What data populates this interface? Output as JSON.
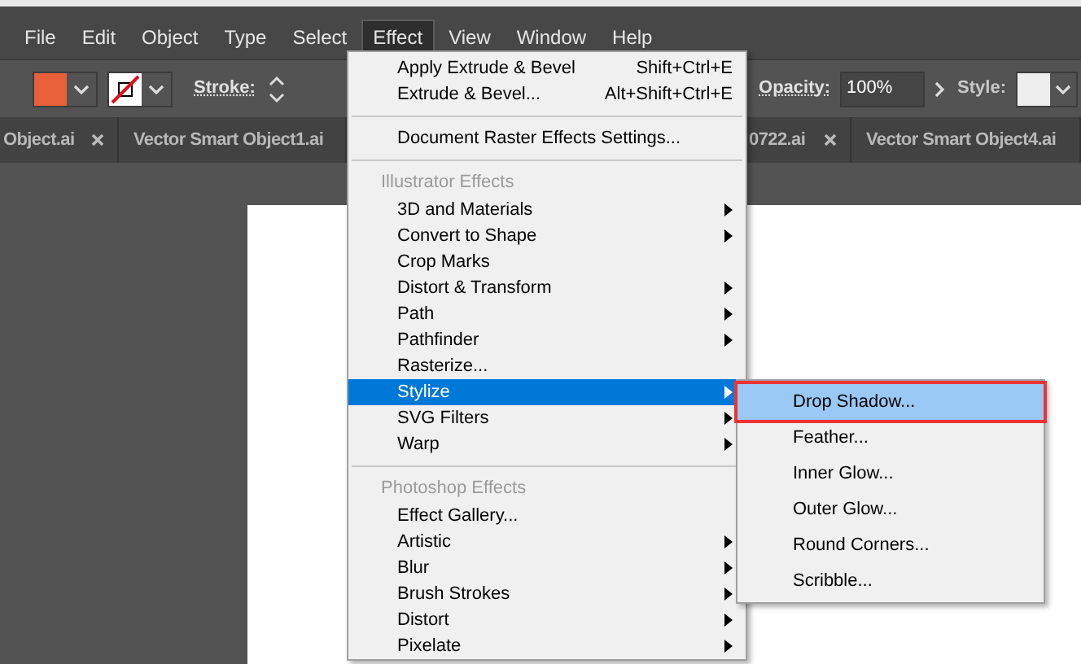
{
  "menu_bar": [
    {
      "label": "File",
      "selected": false
    },
    {
      "label": "Edit",
      "selected": false
    },
    {
      "label": "Object",
      "selected": false
    },
    {
      "label": "Type",
      "selected": false
    },
    {
      "label": "Select",
      "selected": false
    },
    {
      "label": "Effect",
      "selected": true
    },
    {
      "label": "View",
      "selected": false
    },
    {
      "label": "Window",
      "selected": false
    },
    {
      "label": "Help",
      "selected": false
    }
  ],
  "toolbar": {
    "stroke_label": "Stroke:",
    "opacity_label": "Opacity:",
    "opacity_value": "100%",
    "style_label": "Style:"
  },
  "tabs": [
    {
      "label": "Object.ai",
      "closable": true
    },
    {
      "label": "Vector Smart Object1.ai",
      "closable": false
    },
    {
      "label": "0722.ai",
      "closable": true
    },
    {
      "label": "Vector Smart Object4.ai",
      "closable": false
    }
  ],
  "effect_menu": [
    {
      "kind": "item",
      "label": "Apply Extrude & Bevel",
      "shortcut": "Shift+Ctrl+E",
      "submenu": false,
      "selected": false
    },
    {
      "kind": "item",
      "label": "Extrude & Bevel...",
      "shortcut": "Alt+Shift+Ctrl+E",
      "submenu": false,
      "selected": false
    },
    {
      "kind": "separator"
    },
    {
      "kind": "item",
      "label": "Document Raster Effects Settings...",
      "submenu": false,
      "selected": false
    },
    {
      "kind": "separator"
    },
    {
      "kind": "header",
      "label": "Illustrator Effects"
    },
    {
      "kind": "item",
      "label": "3D and Materials",
      "submenu": true,
      "selected": false
    },
    {
      "kind": "item",
      "label": "Convert to Shape",
      "submenu": true,
      "selected": false
    },
    {
      "kind": "item",
      "label": "Crop Marks",
      "submenu": false,
      "selected": false
    },
    {
      "kind": "item",
      "label": "Distort & Transform",
      "submenu": true,
      "selected": false
    },
    {
      "kind": "item",
      "label": "Path",
      "submenu": true,
      "selected": false
    },
    {
      "kind": "item",
      "label": "Pathfinder",
      "submenu": true,
      "selected": false
    },
    {
      "kind": "item",
      "label": "Rasterize...",
      "submenu": false,
      "selected": false
    },
    {
      "kind": "item",
      "label": "Stylize",
      "submenu": true,
      "selected": true
    },
    {
      "kind": "item",
      "label": "SVG Filters",
      "submenu": true,
      "selected": false
    },
    {
      "kind": "item",
      "label": "Warp",
      "submenu": true,
      "selected": false
    },
    {
      "kind": "separator"
    },
    {
      "kind": "header",
      "label": "Photoshop Effects"
    },
    {
      "kind": "item",
      "label": "Effect Gallery...",
      "submenu": false,
      "selected": false
    },
    {
      "kind": "item",
      "label": "Artistic",
      "submenu": true,
      "selected": false
    },
    {
      "kind": "item",
      "label": "Blur",
      "submenu": true,
      "selected": false
    },
    {
      "kind": "item",
      "label": "Brush Strokes",
      "submenu": true,
      "selected": false
    },
    {
      "kind": "item",
      "label": "Distort",
      "submenu": true,
      "selected": false
    },
    {
      "kind": "item",
      "label": "Pixelate",
      "submenu": true,
      "selected": false
    }
  ],
  "stylize_submenu": [
    {
      "label": "Drop Shadow...",
      "selected": true
    },
    {
      "label": "Feather...",
      "selected": false
    },
    {
      "label": "Inner Glow...",
      "selected": false
    },
    {
      "label": "Outer Glow...",
      "selected": false
    },
    {
      "label": "Round Corners...",
      "selected": false
    },
    {
      "label": "Scribble...",
      "selected": false
    }
  ]
}
